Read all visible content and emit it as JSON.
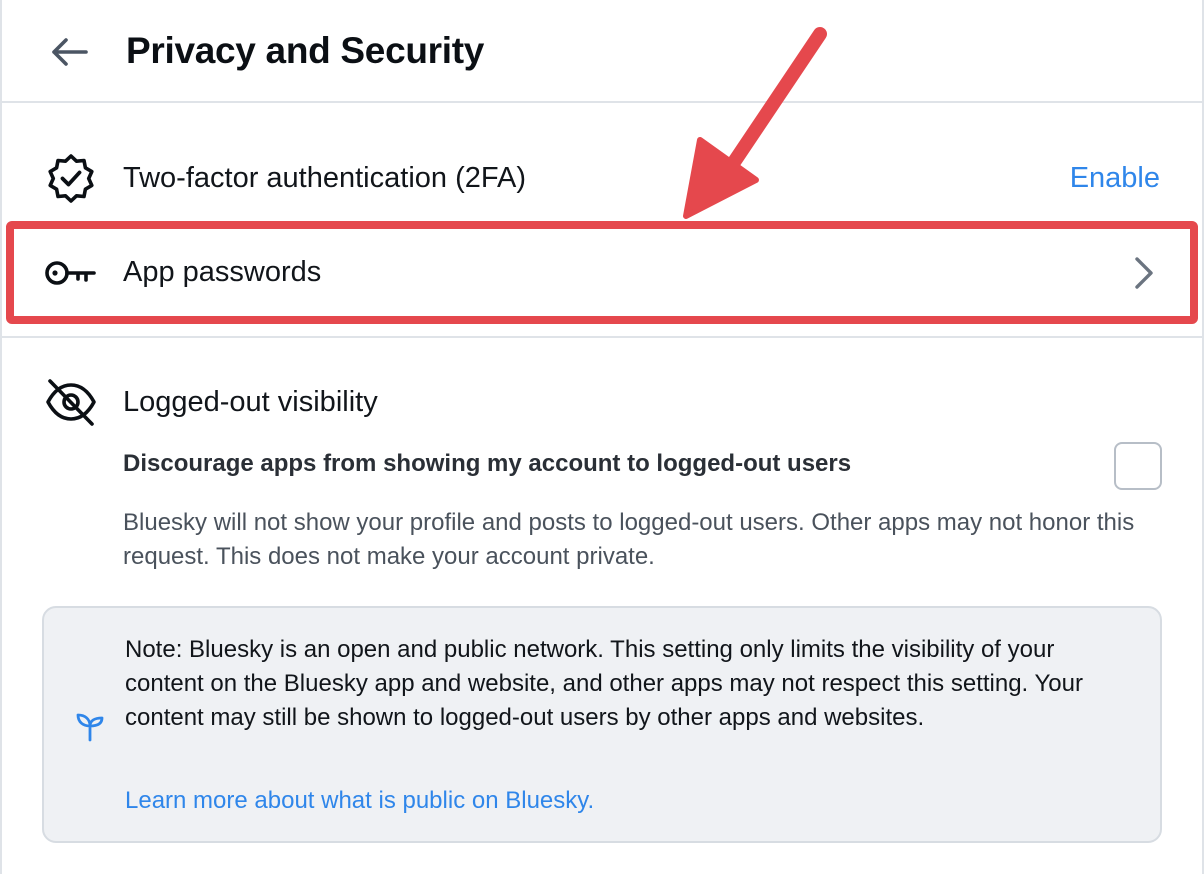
{
  "header": {
    "title": "Privacy and Security",
    "back_icon": "arrow-left-icon"
  },
  "rows": {
    "two_factor": {
      "label": "Two-factor authentication (2FA)",
      "action": "Enable",
      "icon": "badge-check-icon"
    },
    "app_passwords": {
      "label": "App passwords",
      "icon": "key-icon",
      "trailing_icon": "chevron-right-icon"
    },
    "visibility": {
      "label": "Logged-out visibility",
      "icon": "eye-slash-icon"
    }
  },
  "visibility_setting": {
    "title": "Discourage apps from showing my account to logged-out users",
    "checked": false,
    "description": "Bluesky will not show your profile and posts to logged-out users. Other apps may not honor this request. This does not make your account private."
  },
  "note": {
    "icon": "sprout-icon",
    "text": "Note: Bluesky is an open and public network. This setting only limits the visibility of your content on the Bluesky app and website, and other apps may not respect this setting. Your content may still be shown to logged-out users by other apps and websites.",
    "link": "Learn more about what is public on Bluesky."
  },
  "colors": {
    "accent_blue": "#2f86ea",
    "annotation_red": "#e5484d",
    "divider": "#dfe3e8",
    "note_bg": "#eff1f4"
  }
}
